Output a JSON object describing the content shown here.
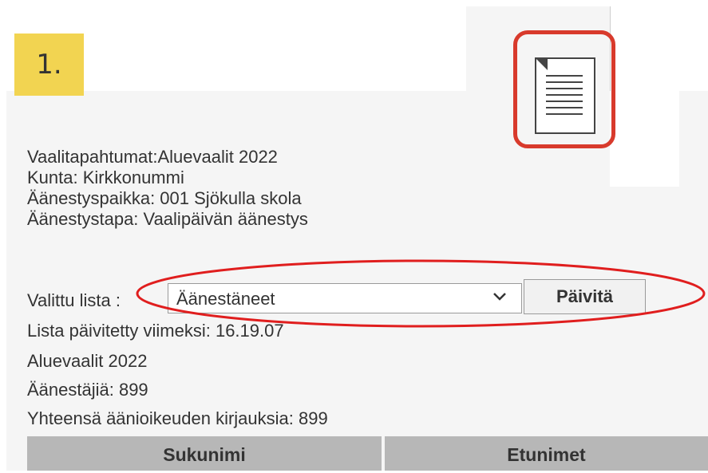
{
  "step": {
    "label": "1."
  },
  "info": {
    "election": "Vaalitapahtumat:Aluevaalit 2022",
    "municipality": "Kunta: Kirkkonummi",
    "polling_place": "Äänestyspaikka: 001 Sjökulla skola",
    "voting_method": "Äänestystapa: Vaalipäivän äänestys"
  },
  "list_selector": {
    "label": "Valittu lista :",
    "selected": "Äänestäneet",
    "button_label": "Päivitä"
  },
  "status": {
    "updated": "Lista päivitetty viimeksi: 16.19.07",
    "election_name": "Aluevaalit 2022",
    "voters": "Äänestäjiä: 899",
    "total_entries": "Yhteensä äänioikeuden kirjauksia: 899"
  },
  "table": {
    "columns": [
      "Sukunimi",
      "Etunimet"
    ]
  },
  "highlight_color": "#d83a2c",
  "icons": {
    "document": "document-icon",
    "dropdown": "chevron-down-icon"
  }
}
